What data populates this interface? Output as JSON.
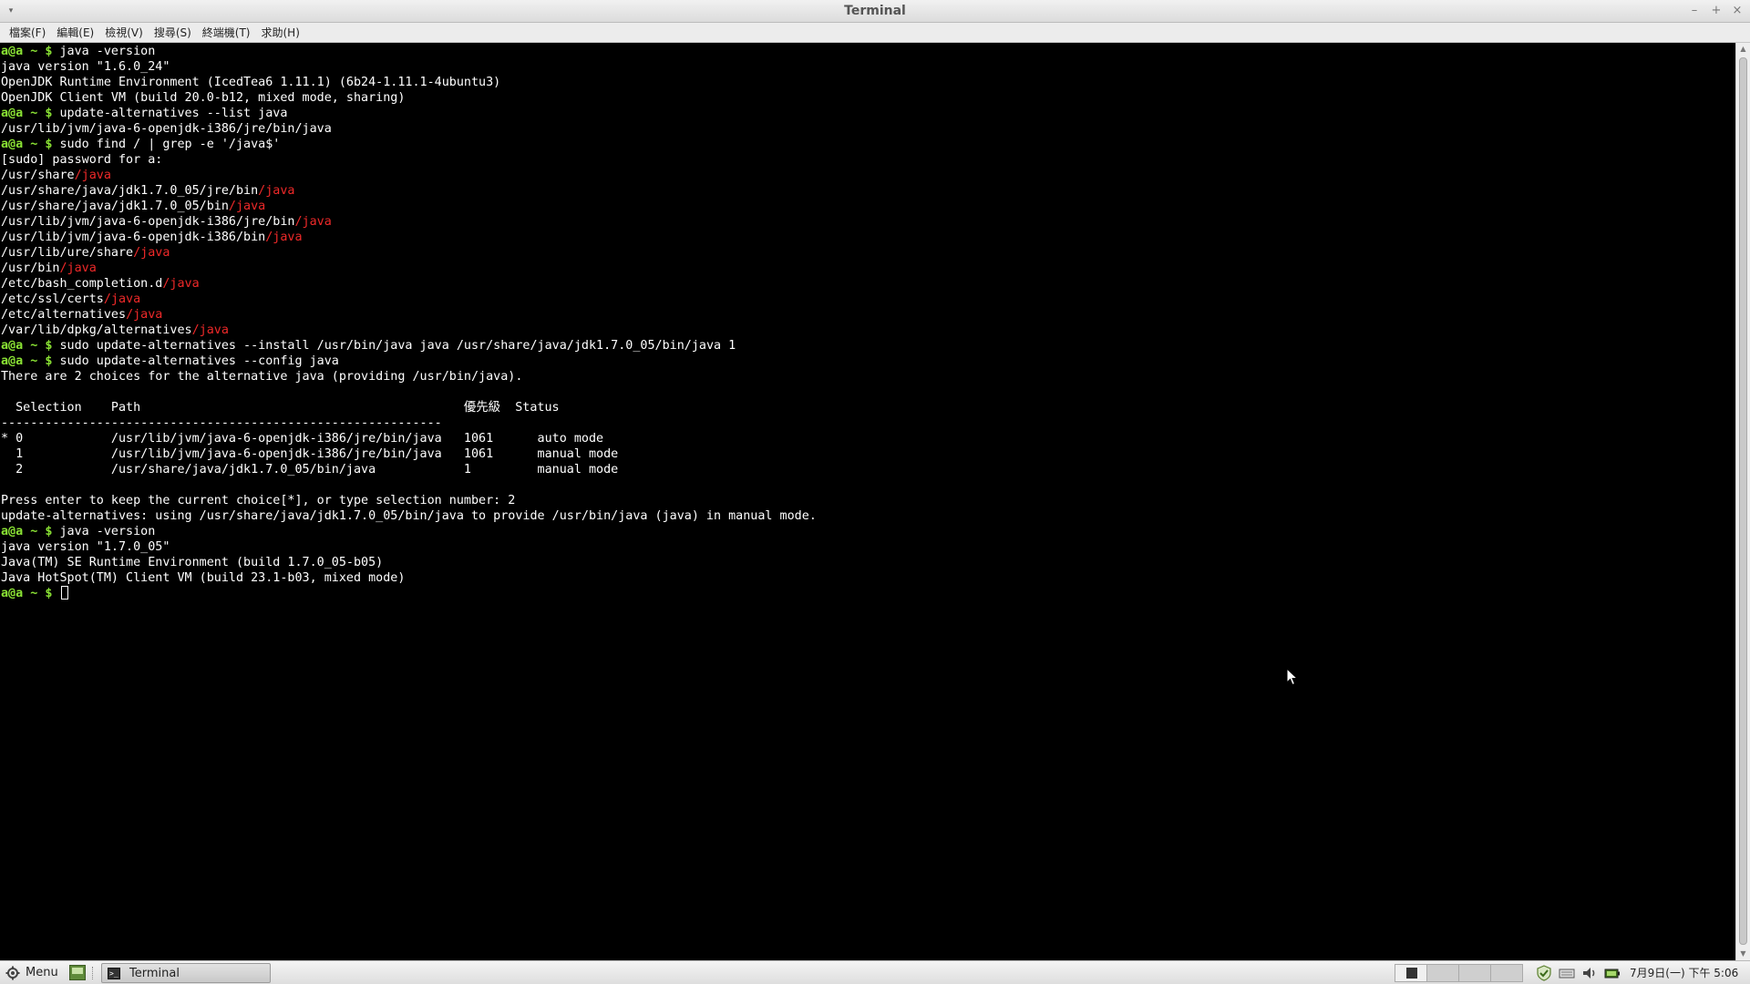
{
  "window": {
    "title": "Terminal"
  },
  "menubar": {
    "items": [
      "檔案(F)",
      "編輯(E)",
      "檢視(V)",
      "搜尋(S)",
      "終端機(T)",
      "求助(H)"
    ]
  },
  "terminal": {
    "lines": [
      [
        [
          "p",
          "a@a ~ $ "
        ],
        [
          "t",
          "java -version"
        ]
      ],
      [
        [
          "t",
          "java version \"1.6.0_24\""
        ]
      ],
      [
        [
          "t",
          "OpenJDK Runtime Environment (IcedTea6 1.11.1) (6b24-1.11.1-4ubuntu3)"
        ]
      ],
      [
        [
          "t",
          "OpenJDK Client VM (build 20.0-b12, mixed mode, sharing)"
        ]
      ],
      [
        [
          "p",
          "a@a ~ $ "
        ],
        [
          "t",
          "update-alternatives --list java"
        ]
      ],
      [
        [
          "t",
          "/usr/lib/jvm/java-6-openjdk-i386/jre/bin/java"
        ]
      ],
      [
        [
          "p",
          "a@a ~ $ "
        ],
        [
          "t",
          "sudo find / | grep -e '/java$'"
        ]
      ],
      [
        [
          "t",
          "[sudo] password for a:"
        ]
      ],
      [
        [
          "t",
          "/usr/share"
        ],
        [
          "r",
          "/java"
        ]
      ],
      [
        [
          "t",
          "/usr/share/java/jdk1.7.0_05/jre/bin"
        ],
        [
          "r",
          "/java"
        ]
      ],
      [
        [
          "t",
          "/usr/share/java/jdk1.7.0_05/bin"
        ],
        [
          "r",
          "/java"
        ]
      ],
      [
        [
          "t",
          "/usr/lib/jvm/java-6-openjdk-i386/jre/bin"
        ],
        [
          "r",
          "/java"
        ]
      ],
      [
        [
          "t",
          "/usr/lib/jvm/java-6-openjdk-i386/bin"
        ],
        [
          "r",
          "/java"
        ]
      ],
      [
        [
          "t",
          "/usr/lib/ure/share"
        ],
        [
          "r",
          "/java"
        ]
      ],
      [
        [
          "t",
          "/usr/bin"
        ],
        [
          "r",
          "/java"
        ]
      ],
      [
        [
          "t",
          "/etc/bash_completion.d"
        ],
        [
          "r",
          "/java"
        ]
      ],
      [
        [
          "t",
          "/etc/ssl/certs"
        ],
        [
          "r",
          "/java"
        ]
      ],
      [
        [
          "t",
          "/etc/alternatives"
        ],
        [
          "r",
          "/java"
        ]
      ],
      [
        [
          "t",
          "/var/lib/dpkg/alternatives"
        ],
        [
          "r",
          "/java"
        ]
      ],
      [
        [
          "p",
          "a@a ~ $ "
        ],
        [
          "t",
          "sudo update-alternatives --install /usr/bin/java java /usr/share/java/jdk1.7.0_05/bin/java 1"
        ]
      ],
      [
        [
          "p",
          "a@a ~ $ "
        ],
        [
          "t",
          "sudo update-alternatives --config java"
        ]
      ],
      [
        [
          "t",
          "There are 2 choices for the alternative java (providing /usr/bin/java)."
        ]
      ],
      [
        [
          "t",
          ""
        ]
      ],
      [
        [
          "t",
          "  Selection    Path                                            優先級  Status"
        ]
      ],
      [
        [
          "t",
          "------------------------------------------------------------"
        ]
      ],
      [
        [
          "t",
          "* 0            /usr/lib/jvm/java-6-openjdk-i386/jre/bin/java   1061      auto mode"
        ]
      ],
      [
        [
          "t",
          "  1            /usr/lib/jvm/java-6-openjdk-i386/jre/bin/java   1061      manual mode"
        ]
      ],
      [
        [
          "t",
          "  2            /usr/share/java/jdk1.7.0_05/bin/java            1         manual mode"
        ]
      ],
      [
        [
          "t",
          ""
        ]
      ],
      [
        [
          "t",
          "Press enter to keep the current choice[*], or type selection number: 2"
        ]
      ],
      [
        [
          "t",
          "update-alternatives: using /usr/share/java/jdk1.7.0_05/bin/java to provide /usr/bin/java (java) in manual mode."
        ]
      ],
      [
        [
          "p",
          "a@a ~ $ "
        ],
        [
          "t",
          "java -version"
        ]
      ],
      [
        [
          "t",
          "java version \"1.7.0_05\""
        ]
      ],
      [
        [
          "t",
          "Java(TM) SE Runtime Environment (build 1.7.0_05-b05)"
        ]
      ],
      [
        [
          "t",
          "Java HotSpot(TM) Client VM (build 23.1-b03, mixed mode)"
        ]
      ],
      [
        [
          "p",
          "a@a ~ $ "
        ],
        [
          "c",
          ""
        ]
      ]
    ]
  },
  "taskbar": {
    "menu_label": "Menu",
    "task_terminal_label": "Terminal",
    "clock": "7月9日(一) 下午 5:06"
  },
  "colors": {
    "prompt": "#8ae234",
    "highlight": "#ef2929",
    "text": "#ffffff",
    "background": "#000000"
  }
}
